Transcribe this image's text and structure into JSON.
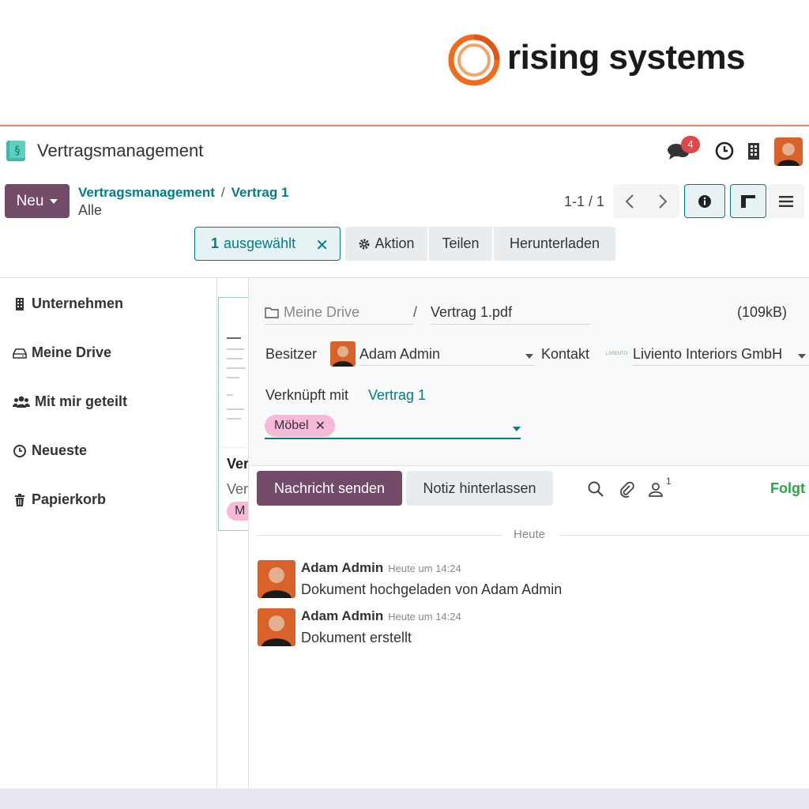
{
  "brand": {
    "name": "rising systems",
    "accent": "#f06c1c"
  },
  "app": {
    "title": "Vertragsmanagement",
    "notification_count": "4"
  },
  "control": {
    "new_label": "Neu",
    "breadcrumb": [
      "Vertragsmanagement",
      "Vertrag 1"
    ],
    "breadcrumb_sep": "/",
    "subtitle": "Alle",
    "pager": "1-1 / 1",
    "selected_count": "1",
    "selected_label": "ausgewählt",
    "actions": [
      "Aktion",
      "Teilen",
      "Herunterladen"
    ]
  },
  "sidebar": {
    "items": [
      {
        "label": "Unternehmen",
        "icon": "building-icon"
      },
      {
        "label": "Meine Drive",
        "icon": "drive-icon"
      },
      {
        "label": "Mit mir geteilt",
        "icon": "users-icon"
      },
      {
        "label": "Neueste",
        "icon": "clock-icon"
      },
      {
        "label": "Papierkorb",
        "icon": "trash-icon"
      }
    ]
  },
  "card": {
    "title": "Ver",
    "subtitle": "Ver",
    "tag": "M"
  },
  "details": {
    "folder": "Meine Drive",
    "separator": "/",
    "filename": "Vertrag 1.pdf",
    "size": "(109kB)",
    "owner_label": "Besitzer",
    "owner": "Adam Admin",
    "contact_label": "Kontakt",
    "contact_logo": "LIVIENTO",
    "contact": "Liviento Interiors GmbH",
    "linked_label": "Verknüpft mit",
    "linked": "Vertrag 1",
    "tag": "Möbel"
  },
  "chatter": {
    "send_label": "Nachricht senden",
    "note_label": "Notiz hinterlassen",
    "follower_count": "1",
    "follow_label": "Folgt",
    "day_label": "Heute",
    "messages": [
      {
        "author": "Adam Admin",
        "date": "Heute um 14:24",
        "body": "Dokument hochgeladen von Adam Admin"
      },
      {
        "author": "Adam Admin",
        "date": "Heute um 14:24",
        "body": "Dokument erstellt"
      }
    ]
  },
  "colors": {
    "primary": "#714b67",
    "teal": "#017e84",
    "follow_green": "#28a745",
    "tag_pink": "#f8b8d8",
    "badge_red": "#e04848"
  }
}
